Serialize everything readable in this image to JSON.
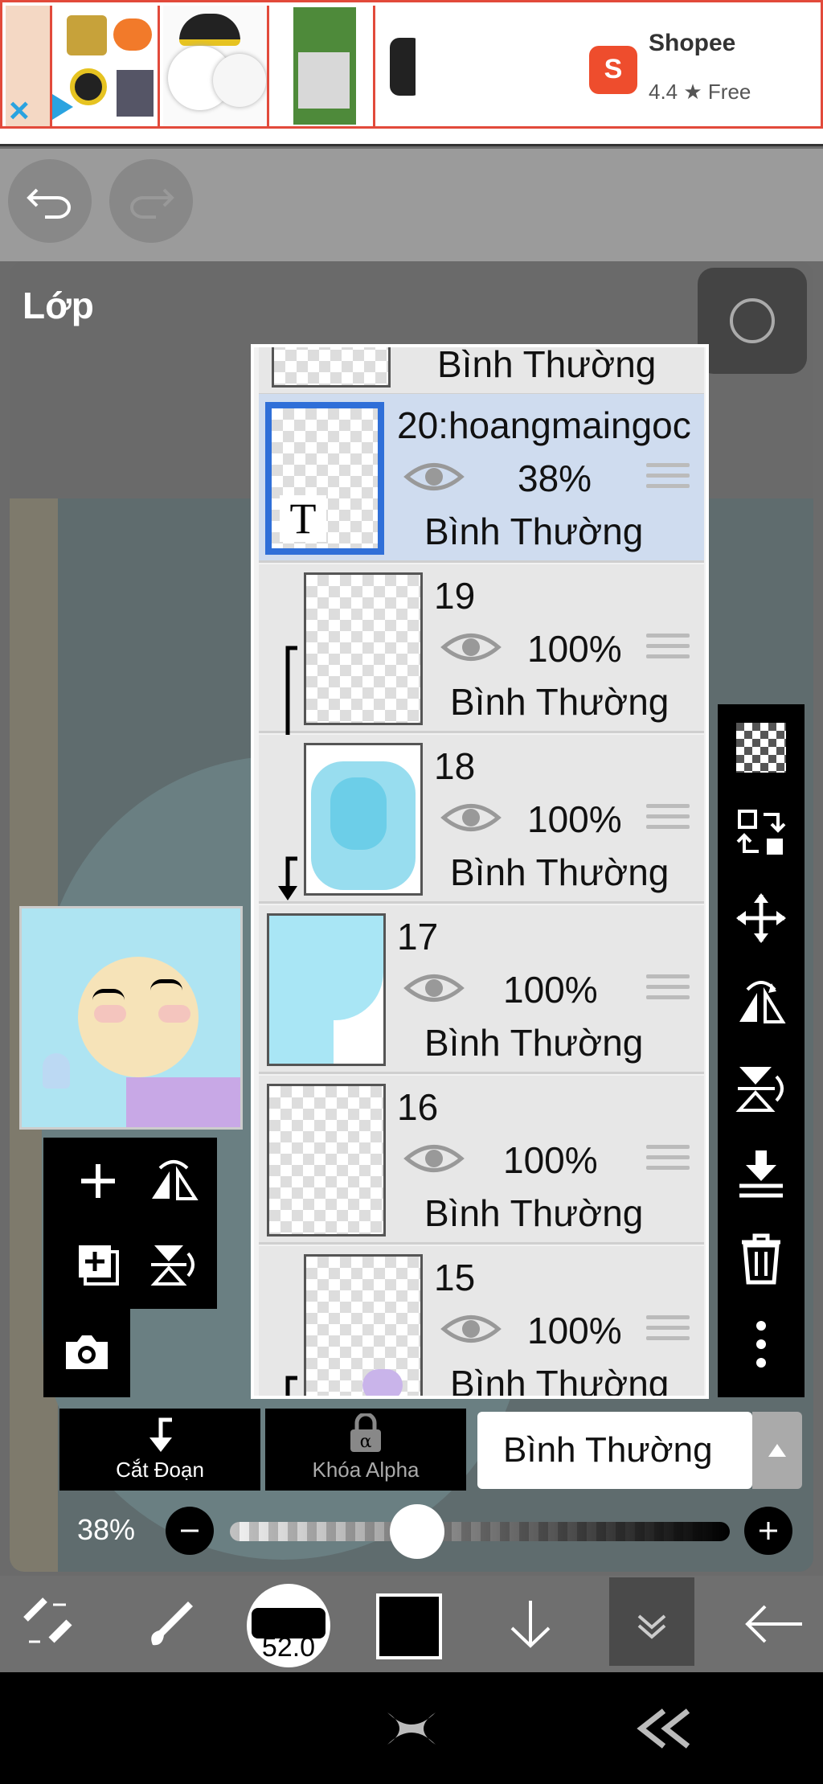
{
  "ad": {
    "brand": "Shopee",
    "rating": "4.4 ★",
    "price": "Free",
    "logo_letter": "S"
  },
  "panel": {
    "title": "Lớp"
  },
  "layers": [
    {
      "name": "",
      "opacity": "",
      "blend": "Bình Thường",
      "partial": true
    },
    {
      "name": "20:hoangmaingoc",
      "opacity": "38%",
      "blend": "Bình Thường",
      "selected": true,
      "text_layer": true,
      "text_glyph": "T"
    },
    {
      "name": "19",
      "opacity": "100%",
      "blend": "Bình Thường",
      "clipped": true
    },
    {
      "name": "18",
      "opacity": "100%",
      "blend": "Bình Thường",
      "clipped": true
    },
    {
      "name": "17",
      "opacity": "100%",
      "blend": "Bình Thường"
    },
    {
      "name": "16",
      "opacity": "100%",
      "blend": "Bình Thường"
    },
    {
      "name": "15",
      "opacity": "100%",
      "blend": "Bình Thường",
      "clipped": true,
      "partial": true
    }
  ],
  "controls": {
    "clip_label": "Cắt Đoạn",
    "alpha_lock_label": "Khóa Alpha",
    "blend_mode": "Bình Thường",
    "opacity_label": "38%",
    "opacity_value": 0.38
  },
  "toolbar": {
    "brush_size": "52.0",
    "color": "#000000"
  }
}
